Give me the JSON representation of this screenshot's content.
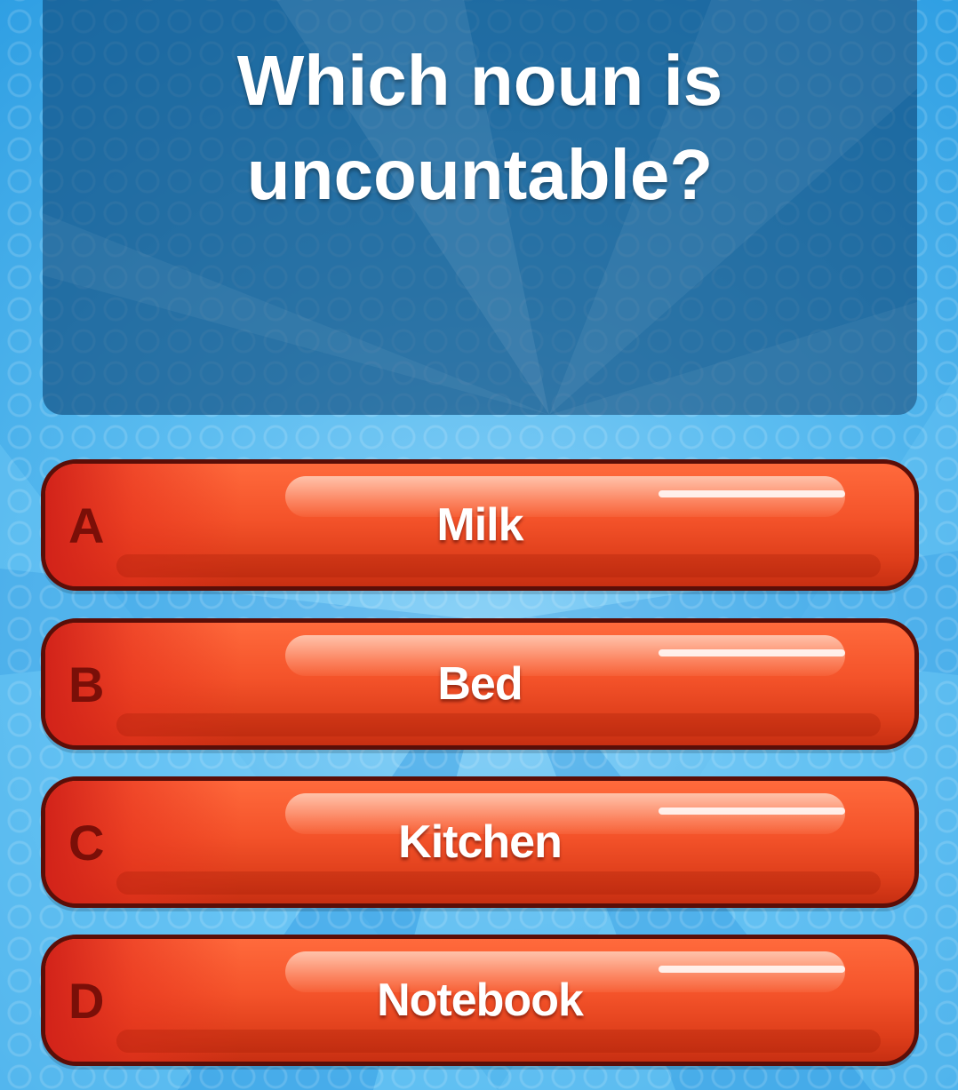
{
  "question": {
    "text": "Which noun is uncountable?"
  },
  "answers": [
    {
      "letter": "A",
      "label": "Milk"
    },
    {
      "letter": "B",
      "label": "Bed"
    },
    {
      "letter": "C",
      "label": "Kitchen"
    },
    {
      "letter": "D",
      "label": "Notebook"
    }
  ],
  "colors": {
    "background": "#5ab8ee",
    "panel": "#0c4678",
    "button": "#f4532a",
    "button_border": "#5a0e08",
    "letter": "#7a0f08"
  }
}
